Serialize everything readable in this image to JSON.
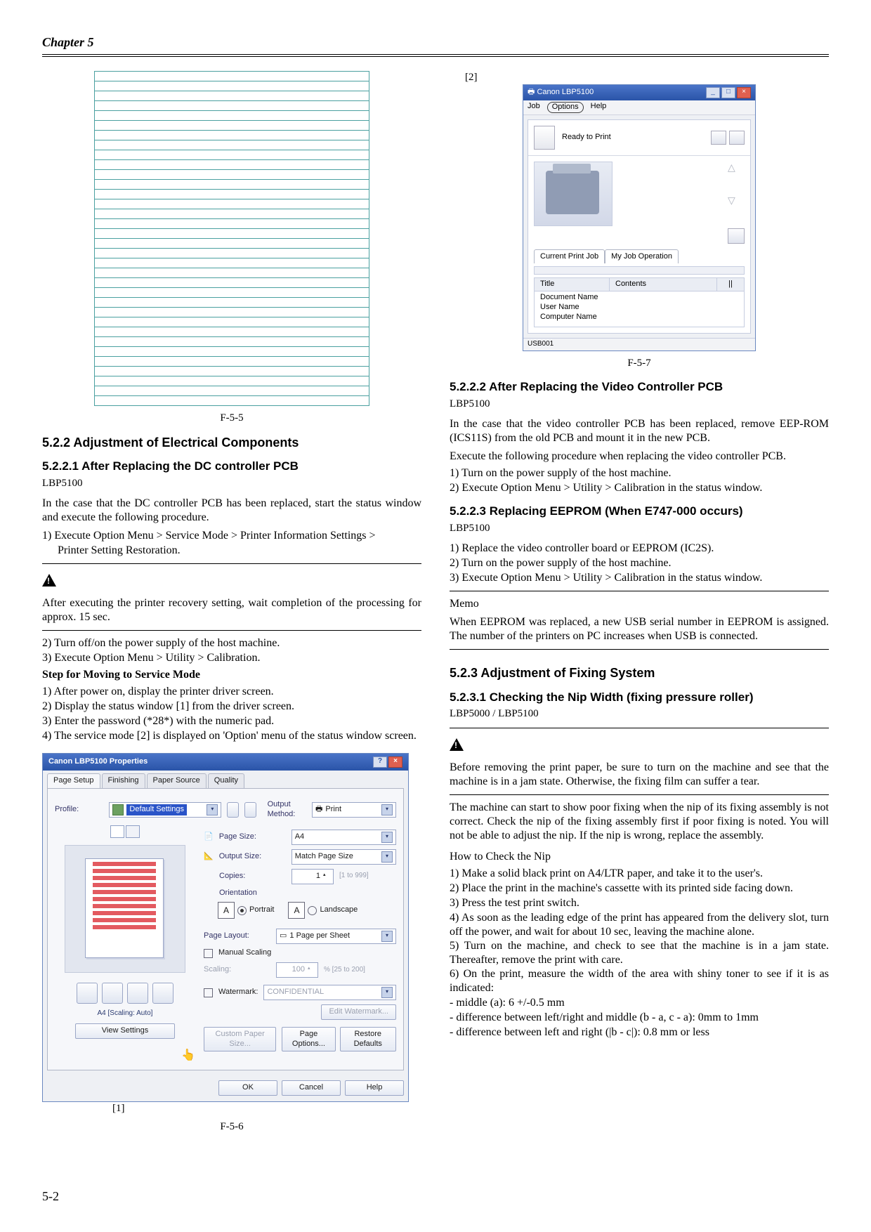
{
  "header": {
    "chapter": "Chapter 5"
  },
  "footer_page": "5-2",
  "fig55": {
    "caption": "F-5-5"
  },
  "s522": {
    "title": "5.2.2 Adjustment of  Electrical Components"
  },
  "s5221": {
    "title": "5.2.2.1 After Replacing the DC controller PCB",
    "model": "LBP5100",
    "intro": "In the case that the DC controller PCB has been replaced, start the status window and execute the following procedure.",
    "step1a": "1) Execute Option Menu > Service Mode > Printer Information Settings >",
    "step1b": "Printer Setting Restoration.",
    "warn1": "After executing the printer recovery setting, wait completion of the processing for approx. 15 sec.",
    "step2": "2) Turn off/on the power supply of the host machine.",
    "step3": "3) Execute Option Menu > Utility > Calibration.",
    "svc_head": "Step for Moving to Service Mode",
    "svc1": "1) After power on, display the printer driver screen.",
    "svc2": "2) Display the status window [1] from the driver screen.",
    "svc3": "3) Enter the password (*28*) with the numeric pad.",
    "svc4": "4) The service mode [2] is displayed on 'Option' menu of the status window screen."
  },
  "fig56": {
    "title": "Canon LBP5100 Properties",
    "tabs": [
      "Page Setup",
      "Finishing",
      "Paper Source",
      "Quality"
    ],
    "profile_label": "Profile:",
    "profile_value": "Default Settings",
    "output_label": "Output Method:",
    "output_value": "Print",
    "page_size_label": "Page Size:",
    "page_size_value": "A4",
    "output_size_label": "Output Size:",
    "output_size_value": "Match Page Size",
    "copies_label": "Copies:",
    "copies_value": "1",
    "copies_hint": "[1 to 999]",
    "orientation_label": "Orientation",
    "portrait": "Portrait",
    "landscape": "Landscape",
    "page_layout_label": "Page Layout:",
    "page_layout_value": "1 Page per Sheet",
    "manual_scaling": "Manual Scaling",
    "scaling": "Scaling:",
    "scaling_value": "100",
    "scaling_hint": "% [25 to 200]",
    "watermark": "Watermark:",
    "watermark_value": "CONFIDENTIAL",
    "edit_watermark": "Edit Watermark...",
    "scale_auto": "A4 [Scaling: Auto]",
    "view_settings": "View Settings",
    "custom_paper": "Custom Paper Size...",
    "page_options": "Page Options...",
    "restore": "Restore Defaults",
    "ok": "OK",
    "cancel": "Cancel",
    "help": "Help",
    "caption": "F-5-6",
    "marker": "[1]"
  },
  "fig57": {
    "marker": "[2]",
    "title": "Canon LBP5100",
    "menu": {
      "job": "Job",
      "options": "Options",
      "help": "Help"
    },
    "status": "Ready to Print",
    "tabs": [
      "Current Print Job",
      "My Job Operation"
    ],
    "cols": {
      "title": "Title",
      "contents": "Contents",
      "pause": "||"
    },
    "rows": [
      "Document Name",
      "User Name",
      "Computer Name"
    ],
    "port": "USB001",
    "caption": "F-5-7"
  },
  "s5222": {
    "title": "5.2.2.2 After Replacing the Video Controller PCB",
    "model": "LBP5100",
    "p1": "In the case that the video controller PCB has been replaced, remove EEP-ROM (ICS11S) from the old PCB and mount it in the new PCB.",
    "p2": "Execute the following procedure when replacing the video controller PCB.",
    "s1": "1) Turn on the power supply of the host machine.",
    "s2": "2) Execute Option Menu > Utility > Calibration in the status window."
  },
  "s5223": {
    "title": "5.2.2.3 Replacing EEPROM (When E747-000 occurs)",
    "model": "LBP5100",
    "s1": "1) Replace the video controller board or EEPROM (IC2S).",
    "s2": "2) Turn on the power supply of the host machine.",
    "s3": "3) Execute Option Menu > Utility > Calibration in the status window.",
    "memo_head": "Memo",
    "memo": "When EEPROM was replaced, a new USB serial number in EEPROM is assigned. The number of the printers on PC increases when USB is connected."
  },
  "s523": {
    "title": "5.2.3 Adjustment of  Fixing System"
  },
  "s5231": {
    "title": "5.2.3.1 Checking the Nip Width (fixing pressure roller)",
    "model": "LBP5000 / LBP5100",
    "warn": "Before removing the print paper, be sure to turn on the machine and see that the machine is in a jam state. Otherwise, the fixing film can suffer a tear.",
    "p1": "The machine can start to show poor fixing when the nip of its fixing assembly is not correct. Check the nip of the fixing assembly first if poor fixing is noted. You will not be able to adjust the nip. If the nip is wrong, replace the assembly.",
    "howto": "How to Check the Nip",
    "s1": "1) Make a solid black print on A4/LTR paper, and take it to the user's.",
    "s2": "2) Place the print in the machine's cassette with its printed side facing down.",
    "s3": "3) Press the test print switch.",
    "s4": "4) As soon as the leading edge of the print has appeared from the delivery slot, turn off the power, and wait for about 10 sec, leaving the machine alone.",
    "s5": "5) Turn on the machine, and check to see that the machine is in a jam state. Thereafter, remove the print with care.",
    "s6": "6) On the print, measure the width of the area with shiny toner to see if it is as indicated:",
    "b1": "- middle (a): 6 +/-0.5 mm",
    "b2": "- difference between left/right and middle (b - a, c - a): 0mm to 1mm",
    "b3": "- difference between left and right (|b - c|): 0.8 mm or less"
  }
}
